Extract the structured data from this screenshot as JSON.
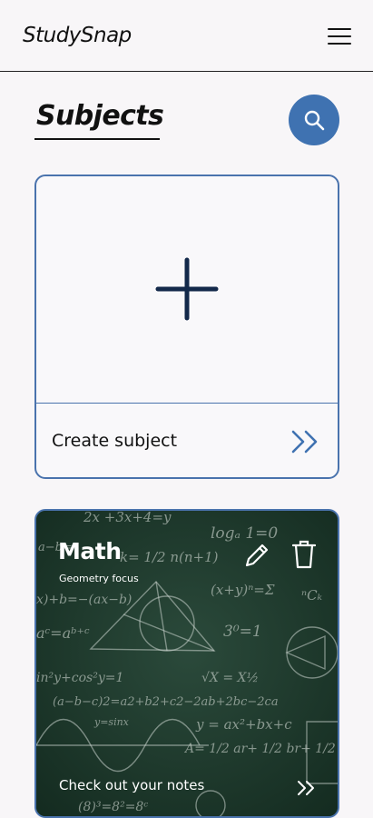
{
  "app": {
    "name": "StudySnap"
  },
  "page": {
    "title": "Subjects"
  },
  "create_card": {
    "label": "Create subject"
  },
  "subjects": [
    {
      "name": "Math",
      "description": "Geometry focus",
      "link_label": "Check out your notes"
    }
  ],
  "chalkboard": {
    "lines": [
      "2x +3x+4=y",
      "logₐ 1=0",
      "a−b=",
      "k= 1/2 n(n+1)",
      "x)+b=−(ax−b)",
      "(x+y)ⁿ=Σ",
      "ⁿCₖ",
      "aᶜ=aᵇ⁺ᶜ",
      "3⁰=1",
      "in²y+cos²y=1",
      "√X = X½",
      "(a−b−c)2=a2+b2+c2−2ab+2bc−2ca",
      "y=sinx",
      "y = ax²+bx+c",
      "A= 1/2 ar+ 1/2 br+ 1/2 cr",
      "(8)³=8²=8ᶜ"
    ]
  },
  "colors": {
    "accent": "#3f72b1",
    "card_border": "#4a73ad",
    "plus": "#13294a",
    "background": "#f8f6f8",
    "board": "#1d3a2c"
  },
  "icons": {
    "menu": "hamburger-icon",
    "search": "search-icon",
    "add": "plus-icon",
    "go": "double-chevron-right-icon",
    "edit": "pencil-icon",
    "delete": "trash-icon"
  }
}
